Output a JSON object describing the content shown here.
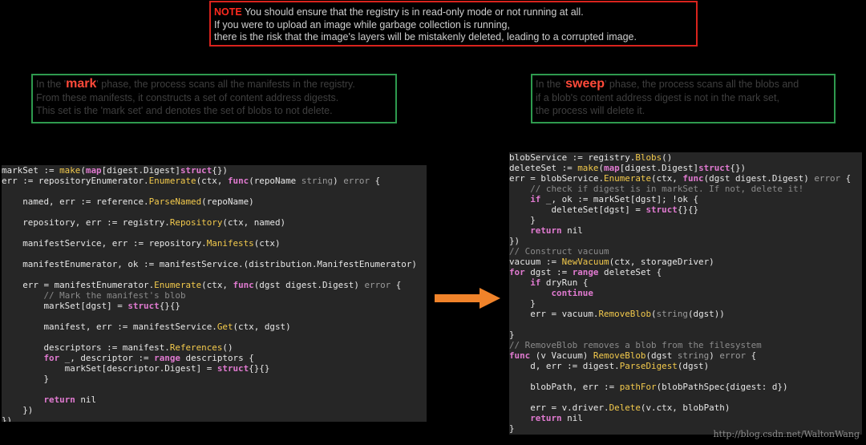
{
  "note": {
    "keyword": "NOTE",
    "line1": " You should ensure that the registry is in read-only mode or not running at all.",
    "line2": "If you were to upload an image while garbage collection is running,",
    "line3": "there is the risk that the image's layers will be mistakenly deleted, leading to a corrupted image."
  },
  "mark_box": {
    "before": "In the ",
    "q1": "'",
    "keyword": "mark",
    "q2": "'",
    "line1_rest": " phase, the process scans all the manifests in the registry.",
    "line2": "From these manifests, it constructs a set of content address digests.",
    "line3": "This set is the 'mark set' and denotes the set of blobs to not delete."
  },
  "sweep_box": {
    "before": "In the ",
    "q1": "'",
    "keyword": "sweep",
    "q2": "'",
    "line1_rest": " phase, the process scans all the blobs and",
    "line2": "if a blob's content address digest is not in the mark set,",
    "line3": "the process will delete it."
  },
  "left_code": [
    "markSet := make(map[digest.Digest]struct{})",
    "err := repositoryEnumerator.Enumerate(ctx, func(repoName string) error {",
    "",
    "    named, err := reference.ParseNamed(repoName)",
    "",
    "    repository, err := registry.Repository(ctx, named)",
    "",
    "    manifestService, err := repository.Manifests(ctx)",
    "",
    "    manifestEnumerator, ok := manifestService.(distribution.ManifestEnumerator)",
    "",
    "    err = manifestEnumerator.Enumerate(ctx, func(dgst digest.Digest) error {",
    "        // Mark the manifest's blob",
    "        markSet[dgst] = struct{}{}",
    "",
    "        manifest, err := manifestService.Get(ctx, dgst)",
    "",
    "        descriptors := manifest.References()",
    "        for _, descriptor := range descriptors {",
    "            markSet[descriptor.Digest] = struct{}{}",
    "        }",
    "",
    "        return nil",
    "    })",
    "})"
  ],
  "right_code": [
    "blobService := registry.Blobs()",
    "deleteSet := make(map[digest.Digest]struct{})",
    "err = blobService.Enumerate(ctx, func(dgst digest.Digest) error {",
    "    // check if digest is in markSet. If not, delete it!",
    "    if _, ok := markSet[dgst]; !ok {",
    "        deleteSet[dgst] = struct{}{}",
    "    }",
    "    return nil",
    "})",
    "// Construct vacuum",
    "vacuum := NewVacuum(ctx, storageDriver)",
    "for dgst := range deleteSet {",
    "    if dryRun {",
    "        continue",
    "    }",
    "    err = vacuum.RemoveBlob(string(dgst))",
    "",
    "}",
    "// RemoveBlob removes a blob from the filesystem",
    "func (v Vacuum) RemoveBlob(dgst string) error {",
    "    d, err := digest.ParseDigest(dgst)",
    "",
    "    blobPath, err := pathFor(blobPathSpec{digest: d})",
    "",
    "    err = v.driver.Delete(v.ctx, blobPath)",
    "    return nil",
    "}"
  ],
  "watermark": "http://blog.csdn.net/WaltonWang",
  "colors": {
    "background": "#000000",
    "note_border": "#d9231d",
    "phase_border": "#2e9a4e",
    "keyword_red": "#ff2a1f",
    "code_bg": "#262626",
    "arrow": "#f0832a"
  }
}
